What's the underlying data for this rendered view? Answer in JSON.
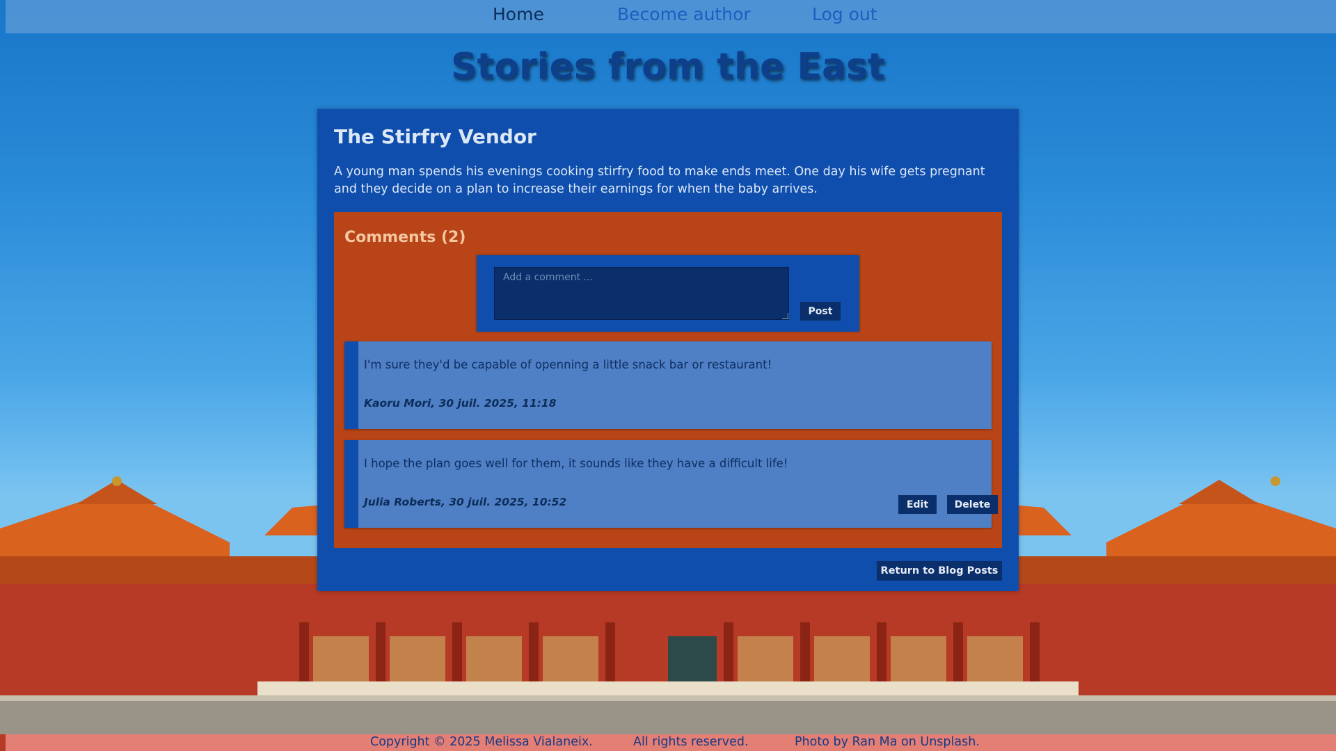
{
  "nav": {
    "home": "Home",
    "become_author": "Become author",
    "logout": "Log out"
  },
  "site_title": "Stories from the East",
  "post": {
    "title": "The Stirfry Vendor",
    "body": "A young man spends his evenings cooking stirfry food to make ends meet. One day his wife gets pregnant and they decide on a plan to increase their earnings for when the baby arrives."
  },
  "comments": {
    "heading": "Comments (2)",
    "input_placeholder": "Add a comment ...",
    "post_label": "Post",
    "items": [
      {
        "text": "I'm sure they'd be capable of openning a little snack bar or restaurant!",
        "meta": "Kaoru Mori, 30 juil. 2025, 11:18"
      },
      {
        "text": "I hope the plan goes well for them, it sounds like they have a difficult life!",
        "meta": "Julia Roberts, 30 juil. 2025, 10:52",
        "edit_label": "Edit",
        "delete_label": "Delete"
      }
    ]
  },
  "return_label": "Return to Blog Posts",
  "footer": {
    "copyright": "Copyright © 2025 Melissa Vialaneix.",
    "rights": "All rights reserved.",
    "photo": "Photo by Ran Ma on Unsplash."
  },
  "colors": {
    "card": "#0f4ead",
    "comments_box": "#b84417",
    "comment_bg": "#4f7fc4",
    "button": "#0a2f6b",
    "title": "#0d3f8a"
  }
}
